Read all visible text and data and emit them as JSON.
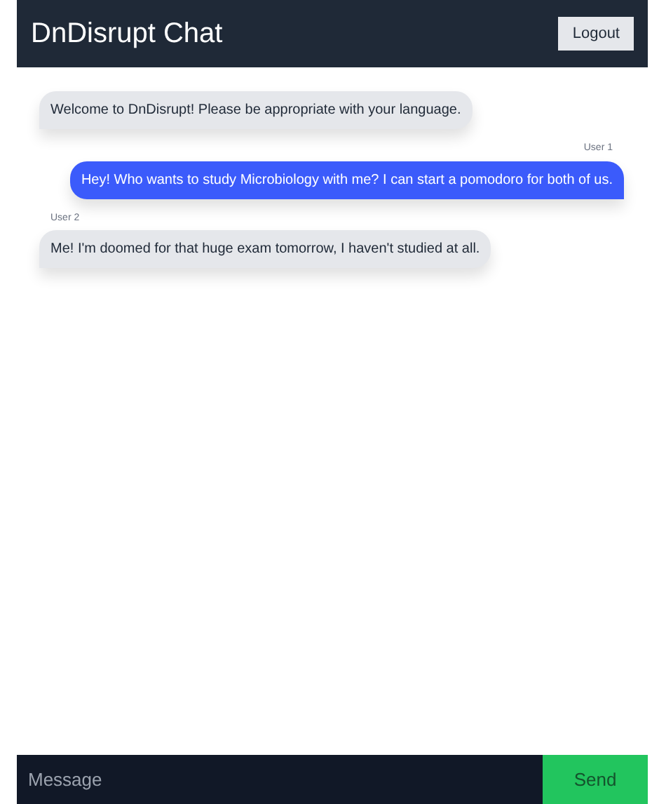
{
  "header": {
    "title": "DnDisrupt Chat",
    "logout_button": "Logout"
  },
  "messages": [
    {
      "kind": "received",
      "text": "Welcome to DnDisrupt! Please be appropriate with your language."
    },
    {
      "kind": "sent",
      "sender": "User 1",
      "text": "Hey! Who wants to study Microbiology with me? I can start a pomodoro for both of us."
    },
    {
      "kind": "received",
      "sender": "User 2",
      "text": "Me! I'm doomed for that huge exam tomorrow, I haven't studied at all."
    }
  ],
  "composer": {
    "placeholder": "Message",
    "send_button": "Send"
  }
}
